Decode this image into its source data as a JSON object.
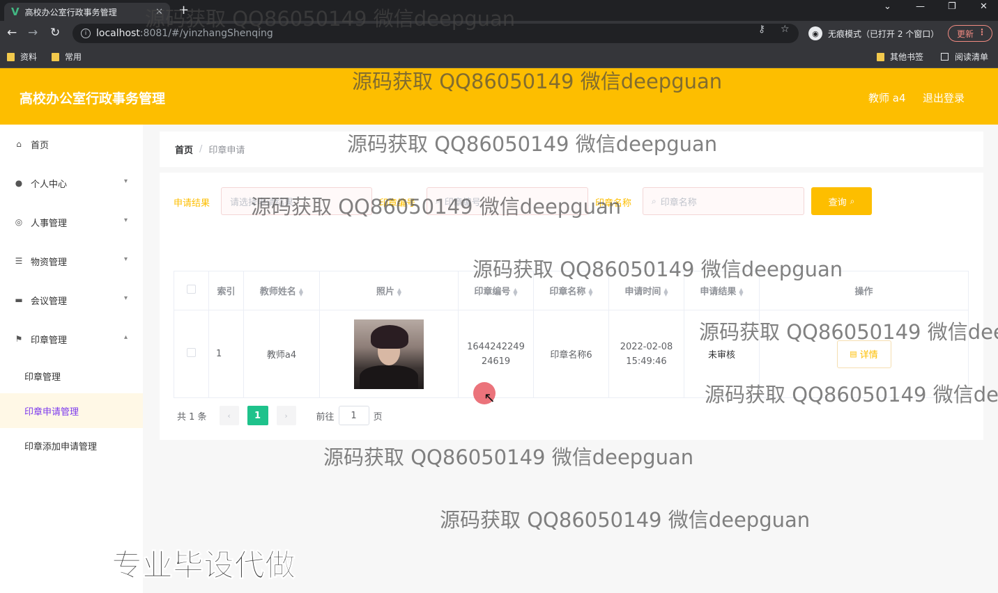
{
  "browser": {
    "tab_title": "高校办公室行政事务管理",
    "tab_logo": "V",
    "tab_close": "✕",
    "new_tab": "+",
    "url_host": "localhost",
    "url_path": ":8081/#/yinzhangShenqing",
    "incognito_label": "无痕模式（已打开 2 个窗口）",
    "update_label": "更新",
    "bookmarks": [
      "资料",
      "常用"
    ],
    "bookmarks_right": [
      "其他书签",
      "阅读清单"
    ]
  },
  "header": {
    "title": "高校办公室行政事务管理",
    "user": "教师 a4",
    "logout": "退出登录"
  },
  "sidebar": {
    "items": [
      {
        "label": "首页",
        "icon": "home-icon"
      },
      {
        "label": "个人中心",
        "icon": "user-icon"
      },
      {
        "label": "人事管理",
        "icon": "compass-icon"
      },
      {
        "label": "物资管理",
        "icon": "list-icon"
      },
      {
        "label": "会议管理",
        "icon": "monitor-icon"
      },
      {
        "label": "印章管理",
        "icon": "flag-icon"
      }
    ],
    "sub_items": [
      "印章管理",
      "印章申请管理",
      "印章添加申请管理"
    ],
    "active_sub": "印章申请管理"
  },
  "breadcrumb": {
    "home": "首页",
    "separator": "/",
    "current": "印章申请"
  },
  "search": {
    "field1_label": "申请结果",
    "field1_placeholder": "请选择申请结果",
    "field2_label": "印章编号",
    "field2_placeholder": "印章编号",
    "field3_label": "印章名称",
    "field3_placeholder": "印章名称",
    "button_label": "查询"
  },
  "table": {
    "headers": [
      "索引",
      "教师姓名",
      "照片",
      "印章编号",
      "印章名称",
      "申请时间",
      "申请结果",
      "操作"
    ],
    "rows": [
      {
        "index": "1",
        "teacher": "教师a4",
        "seal_no_line1": "1644242249",
        "seal_no_line2": "24619",
        "seal_name": "印章名称6",
        "time_line1": "2022-02-08",
        "time_line2": "15:49:46",
        "result": "未审核",
        "action": "详情"
      }
    ]
  },
  "pager": {
    "total": "共 1 条",
    "current_page": "1",
    "goto_label": "前往",
    "goto_value": "1",
    "page_unit": "页"
  },
  "watermark_text": "源码获取 QQ86050149 微信deepguan",
  "promo_text": "专业毕设代做",
  "colors": {
    "accent": "#fdbe00",
    "active_page": "#1ec28b",
    "active_sub_text": "#7c3aed"
  }
}
